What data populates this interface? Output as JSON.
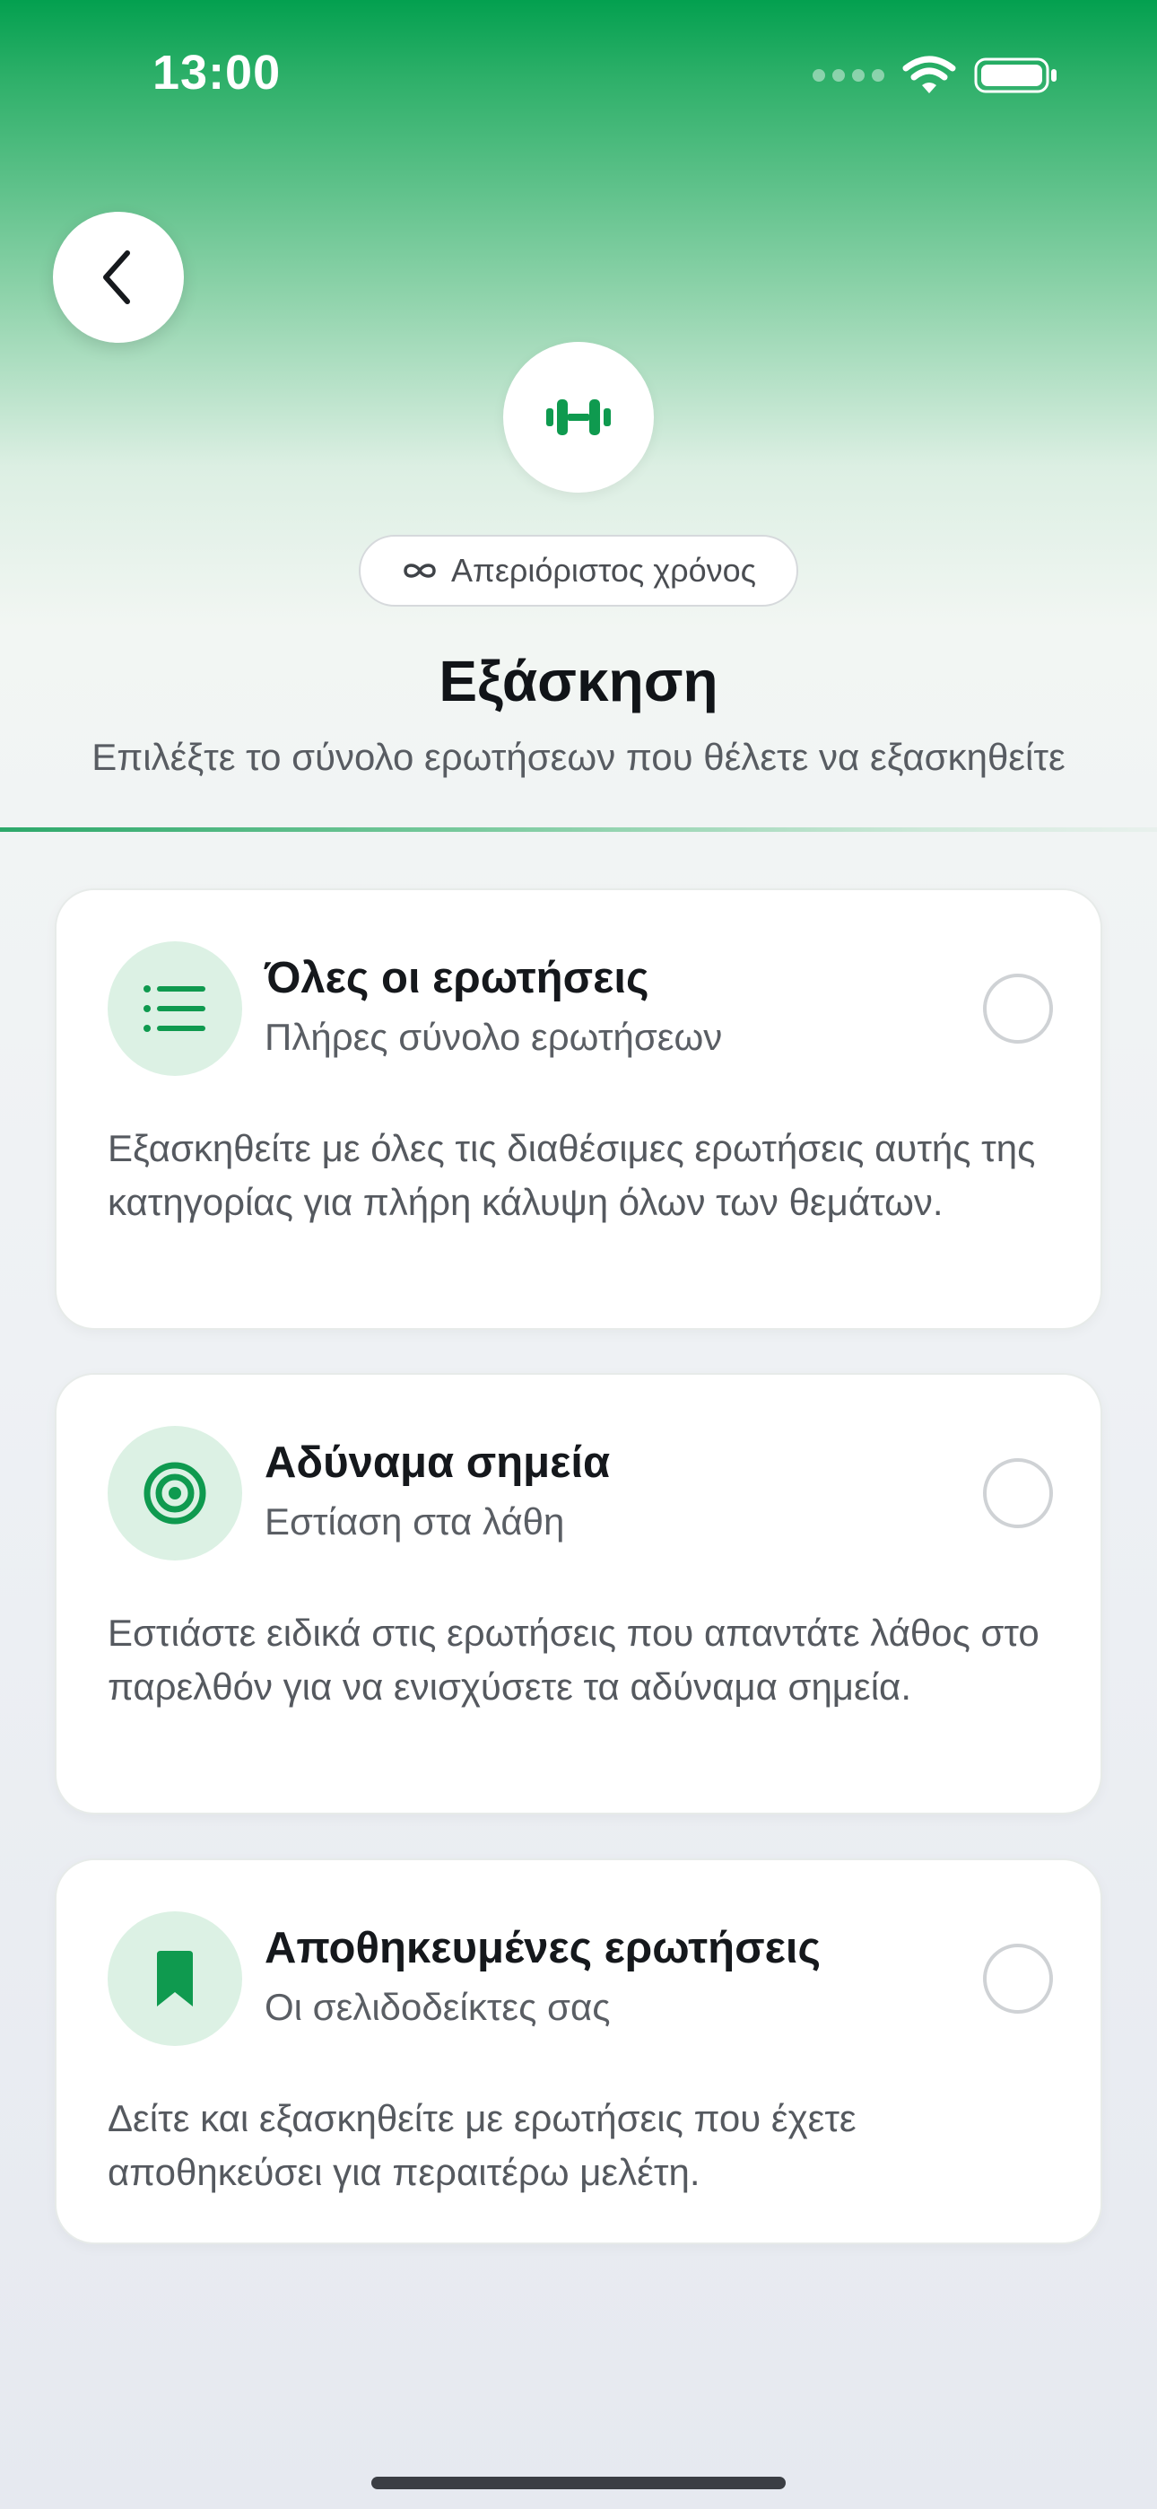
{
  "status_bar": {
    "time": "13:00",
    "icons": [
      "signal-dots-icon",
      "wifi-icon",
      "battery-icon"
    ]
  },
  "header": {
    "back_icon": "chevron-left-icon",
    "hero_icon": "dumbbell-icon",
    "time_badge": {
      "icon": "infinity-icon",
      "label": "Απεριόριστος χρόνος"
    },
    "title": "Εξάσκηση",
    "subtitle": "Επιλέξτε το σύνολο ερωτήσεων που θέλετε να εξασκηθείτε"
  },
  "options": [
    {
      "icon": "list-icon",
      "title": "Όλες οι ερωτήσεις",
      "subtitle": "Πλήρες σύνολο ερωτήσεων",
      "description": "Εξασκηθείτε με όλες τις διαθέσιμες ερωτήσεις αυτής της κατηγορίας για πλήρη κάλυψη όλων των θεμάτων.",
      "selected": false
    },
    {
      "icon": "target-icon",
      "title": "Αδύναμα σημεία",
      "subtitle": "Εστίαση στα λάθη",
      "description": "Εστιάστε ειδικά στις ερωτήσεις που απαντάτε λάθος στο παρελθόν για να ενισχύσετε τα αδύναμα σημεία.",
      "selected": false
    },
    {
      "icon": "bookmark-icon",
      "title": "Αποθηκευμένες ερωτήσεις",
      "subtitle": "Οι σελιδοδείκτες σας",
      "description": "Δείτε και εξασκηθείτε με ερωτήσεις που έχετε αποθηκεύσει για περαιτέρω μελέτη.",
      "selected": false
    }
  ],
  "colors": {
    "accent": "#0f9a4f",
    "accent_light": "#dcf1e4",
    "header_gradient_top": "#03a04f"
  }
}
